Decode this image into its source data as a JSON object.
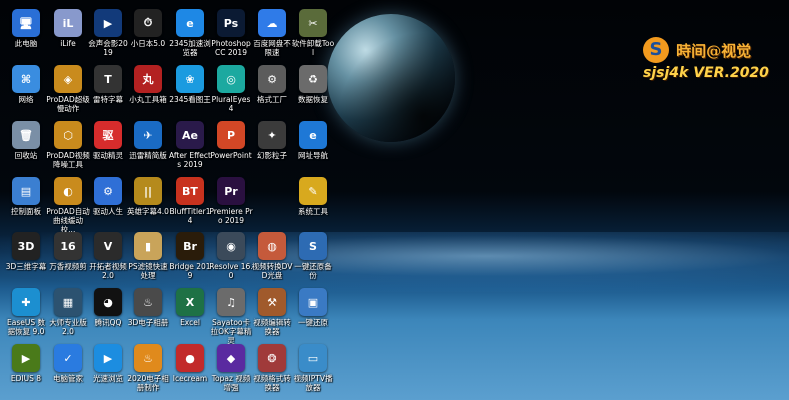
{
  "watermark": {
    "logo": "S",
    "title": "時间@视觉",
    "subtitle": "sjsj4k VER.2020"
  },
  "icons": [
    {
      "label": "此电脑",
      "glyph": "🖥",
      "bg": "#2a6fd6",
      "icon_name": "this-pc-icon"
    },
    {
      "label": "iLife",
      "glyph": "iL",
      "bg": "#8899cc",
      "icon_name": "ilife-icon"
    },
    {
      "label": "会声会影2019",
      "glyph": "▶",
      "bg": "#123a7a",
      "icon_name": "videostudio-icon"
    },
    {
      "label": "小日本5.0",
      "glyph": "⏱",
      "bg": "#222222",
      "icon_name": "speedometer-icon"
    },
    {
      "label": "2345加速浏览器",
      "glyph": "e",
      "bg": "#1e88e5",
      "icon_name": "browser-2345-icon"
    },
    {
      "label": "Photoshop CC 2019",
      "glyph": "Ps",
      "bg": "#0b1a33",
      "icon_name": "photoshop-icon"
    },
    {
      "label": "百度网盘不限速",
      "glyph": "☁",
      "bg": "#2f7be8",
      "icon_name": "baidu-netdisk-icon"
    },
    {
      "label": "软件卸载Tool",
      "glyph": "✂",
      "bg": "#5a6b3a",
      "icon_name": "uninstall-tool-icon"
    },
    {
      "label": "网络",
      "glyph": "⌘",
      "bg": "#3a8de0",
      "icon_name": "network-icon"
    },
    {
      "label": "ProDAD超级慢动作",
      "glyph": "◈",
      "bg": "#c98b1d",
      "icon_name": "prodad-slowmo-icon"
    },
    {
      "label": "雷特字幕",
      "glyph": "T",
      "bg": "#333333",
      "icon_name": "subtitle-icon"
    },
    {
      "label": "小丸工具箱",
      "glyph": "丸",
      "bg": "#b32121",
      "icon_name": "xiaowan-toolbox-icon"
    },
    {
      "label": "2345看图王",
      "glyph": "❀",
      "bg": "#1b9be0",
      "icon_name": "image-viewer-2345-icon"
    },
    {
      "label": "PluralEyes 4",
      "glyph": "◎",
      "bg": "#1ca9a0",
      "icon_name": "pluraleyes-icon"
    },
    {
      "label": "格式工厂",
      "glyph": "⚙",
      "bg": "#5c5c5c",
      "icon_name": "format-factory-icon"
    },
    {
      "label": "数据恢复",
      "glyph": "♻",
      "bg": "#6b6b6b",
      "icon_name": "data-recovery-icon"
    },
    {
      "label": "回收站",
      "glyph": "🗑",
      "bg": "#7a8fa6",
      "icon_name": "recycle-bin-icon"
    },
    {
      "label": "ProDAD视频降噪工具",
      "glyph": "⬡",
      "bg": "#c98b1d",
      "icon_name": "prodad-denoise-icon"
    },
    {
      "label": "驱动精灵",
      "glyph": "驱",
      "bg": "#d62c2c",
      "icon_name": "driver-genius-icon"
    },
    {
      "label": "迅雷精简版",
      "glyph": "✈",
      "bg": "#1a6bc4",
      "icon_name": "xunlei-icon"
    },
    {
      "label": "After Effects 2019",
      "glyph": "Ae",
      "bg": "#2a1a4a",
      "icon_name": "after-effects-icon"
    },
    {
      "label": "PowerPoint",
      "glyph": "P",
      "bg": "#d24726",
      "icon_name": "powerpoint-icon"
    },
    {
      "label": "幻影粒子",
      "glyph": "✦",
      "bg": "#3b3b3b",
      "icon_name": "particle-icon"
    },
    {
      "label": "网址导航",
      "glyph": "e",
      "bg": "#1e78d6",
      "icon_name": "web-navigation-icon"
    },
    {
      "label": "控制面板",
      "glyph": "▤",
      "bg": "#3b7fd1",
      "icon_name": "control-panel-icon"
    },
    {
      "label": "ProDAD自动曲线缓动校...",
      "glyph": "◐",
      "bg": "#c98b1d",
      "icon_name": "prodad-curve-icon"
    },
    {
      "label": "驱动人生",
      "glyph": "⚙",
      "bg": "#2f6fd6",
      "icon_name": "driver-life-icon"
    },
    {
      "label": "英雄字幕4.0",
      "glyph": "||",
      "bg": "#b58a1c",
      "icon_name": "hero-subtitle-icon"
    },
    {
      "label": "BluffTitler14",
      "glyph": "BT",
      "bg": "#c8321e",
      "icon_name": "blufftitler-icon"
    },
    {
      "label": "Premiere Pro 2019",
      "glyph": "Pr",
      "bg": "#2a1040",
      "icon_name": "premiere-icon"
    },
    {
      "label": "",
      "glyph": "",
      "bg": "transparent",
      "icon_name": "blank-slot-icon"
    },
    {
      "label": "系统工具",
      "glyph": "✎",
      "bg": "#d8a91e",
      "icon_name": "system-tools-icon"
    },
    {
      "label": "3D三维字幕",
      "glyph": "3D",
      "bg": "#222222",
      "icon_name": "3d-subtitle-icon"
    },
    {
      "label": "万香视频剪",
      "glyph": "16",
      "bg": "#333333",
      "icon_name": "video-cut-icon"
    },
    {
      "label": "开拓者视频2.0",
      "glyph": "V",
      "bg": "#2b2b2b",
      "icon_name": "video-pioneer-icon"
    },
    {
      "label": "PS滤镜快速处理",
      "glyph": "▮",
      "bg": "#c9a45a",
      "icon_name": "ps-filter-icon"
    },
    {
      "label": "Bridge 2019",
      "glyph": "Br",
      "bg": "#2a1c0a",
      "icon_name": "bridge-icon"
    },
    {
      "label": "Resolve 16.0",
      "glyph": "◉",
      "bg": "#3b4a5a",
      "icon_name": "davinci-resolve-icon"
    },
    {
      "label": "视频转换DVD光盘",
      "glyph": "◍",
      "bg": "#c55a3b",
      "icon_name": "dvd-icon"
    },
    {
      "label": "一键还原备份",
      "glyph": "S",
      "bg": "#2d6bb3",
      "icon_name": "restore-backup-icon"
    },
    {
      "label": "EaseUS 数据恢复 9.0",
      "glyph": "✚",
      "bg": "#1c8fd0",
      "icon_name": "easeus-icon"
    },
    {
      "label": "大师专业版2.0",
      "glyph": "▦",
      "bg": "#2c5270",
      "icon_name": "master-pro-icon"
    },
    {
      "label": "腾讯QQ",
      "glyph": "◕",
      "bg": "#111111",
      "icon_name": "qq-icon"
    },
    {
      "label": "3D电子相册",
      "glyph": "♨",
      "bg": "#4a4a4a",
      "icon_name": "3d-album-icon"
    },
    {
      "label": "Excel",
      "glyph": "X",
      "bg": "#1e7145",
      "icon_name": "excel-icon"
    },
    {
      "label": "Sayatoo卡拉OK字幕精灵",
      "glyph": "♫",
      "bg": "#6b6b6b",
      "icon_name": "sayatoo-icon"
    },
    {
      "label": "视频编辑转换器",
      "glyph": "⚒",
      "bg": "#a05a2c",
      "icon_name": "video-converter-icon"
    },
    {
      "label": "一键还原",
      "glyph": "▣",
      "bg": "#3a7ac4",
      "icon_name": "one-key-restore-icon"
    },
    {
      "label": "EDIUS 8",
      "glyph": "▶",
      "bg": "#4a7a1a",
      "icon_name": "edius-icon"
    },
    {
      "label": "电脑管家",
      "glyph": "✓",
      "bg": "#2a7be0",
      "icon_name": "pc-manager-icon"
    },
    {
      "label": "光速浏览",
      "glyph": "▶",
      "bg": "#1c8de0",
      "icon_name": "light-browser-icon"
    },
    {
      "label": "2020电子相册制作",
      "glyph": "♨",
      "bg": "#e08a1c",
      "icon_name": "album-2020-icon"
    },
    {
      "label": "Icecream",
      "glyph": "●",
      "bg": "#c22a2a",
      "icon_name": "icecream-icon"
    },
    {
      "label": "Topaz 视频增强",
      "glyph": "◆",
      "bg": "#5a2aa0",
      "icon_name": "topaz-icon"
    },
    {
      "label": "视频格式转换器",
      "glyph": "❂",
      "bg": "#a03a3a",
      "icon_name": "format-converter-icon"
    },
    {
      "label": "视频IPTV播放器",
      "glyph": "▭",
      "bg": "#3a8cc9",
      "icon_name": "iptv-player-icon"
    }
  ]
}
